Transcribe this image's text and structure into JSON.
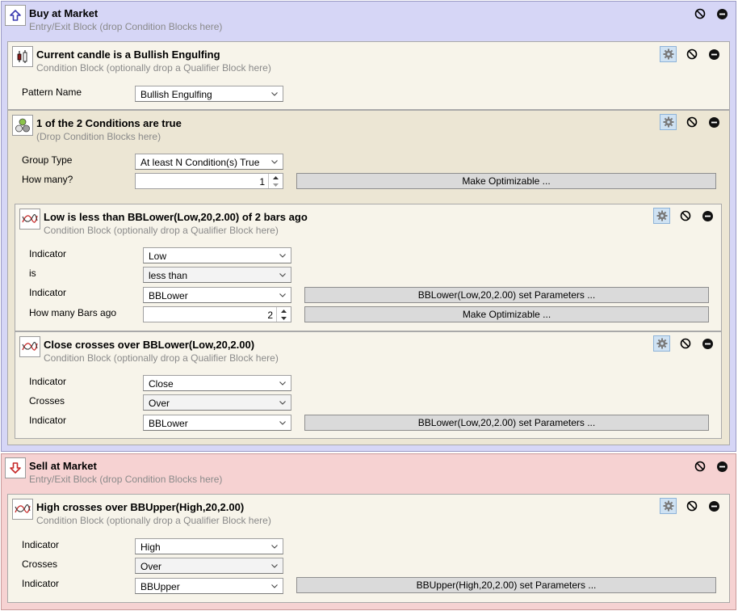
{
  "buy": {
    "title": "Buy at Market",
    "subtitle": "Entry/Exit Block (drop Condition Blocks here)",
    "icon": "up-arrow-icon",
    "candle_block": {
      "title": "Current candle is a Bullish Engulfing",
      "subtitle": "Condition Block (optionally drop a Qualifier Block here)",
      "pattern_label": "Pattern Name",
      "pattern_value": "Bullish Engulfing"
    },
    "group_block": {
      "title": "1 of the 2 Conditions are true",
      "subtitle": "(Drop Condition Blocks here)",
      "group_type_label": "Group Type",
      "group_type_value": "At least N Condition(s) True",
      "how_many_label": "How many?",
      "how_many_value": "1",
      "optimize_label": "Make Optimizable ...",
      "low_block": {
        "title": "Low is less than BBLower(Low,20,2.00) of 2 bars ago",
        "subtitle": "Condition Block (optionally drop a Qualifier Block here)",
        "indicator_label": "Indicator",
        "indicator_value": "Low",
        "is_label": "is",
        "is_value": "less than",
        "indicator2_label": "Indicator",
        "indicator2_value": "BBLower",
        "params_label": "BBLower(Low,20,2.00) set Parameters ...",
        "bars_ago_label": "How many Bars ago",
        "bars_ago_value": "2",
        "optimize_label": "Make Optimizable ..."
      },
      "close_block": {
        "title": "Close crosses over BBLower(Low,20,2.00)",
        "subtitle": "Condition Block (optionally drop a Qualifier Block here)",
        "indicator_label": "Indicator",
        "indicator_value": "Close",
        "crosses_label": "Crosses",
        "crosses_value": "Over",
        "indicator2_label": "Indicator",
        "indicator2_value": "BBLower",
        "params_label": "BBLower(Low,20,2.00) set Parameters ..."
      }
    }
  },
  "sell": {
    "title": "Sell at Market",
    "subtitle": "Entry/Exit Block (drop Condition Blocks here)",
    "icon": "down-arrow-icon",
    "high_block": {
      "title": "High crosses over BBUpper(High,20,2.00)",
      "subtitle": "Condition Block (optionally drop a Qualifier Block here)",
      "indicator_label": "Indicator",
      "indicator_value": "High",
      "crosses_label": "Crosses",
      "crosses_value": "Over",
      "indicator2_label": "Indicator",
      "indicator2_value": "BBUpper",
      "params_label": "BBUpper(High,20,2.00) set Parameters ..."
    }
  },
  "colors": {
    "buy_panel": "#d6d6f6",
    "sell_panel": "#f6d2d2",
    "condition_block": "#f7f4ea",
    "group_block": "#ece6d4",
    "button_face": "#dadada",
    "gear_highlight": "#cfe2f3",
    "buy_arrow": "#3b3bb0",
    "sell_arrow": "#c62828"
  }
}
